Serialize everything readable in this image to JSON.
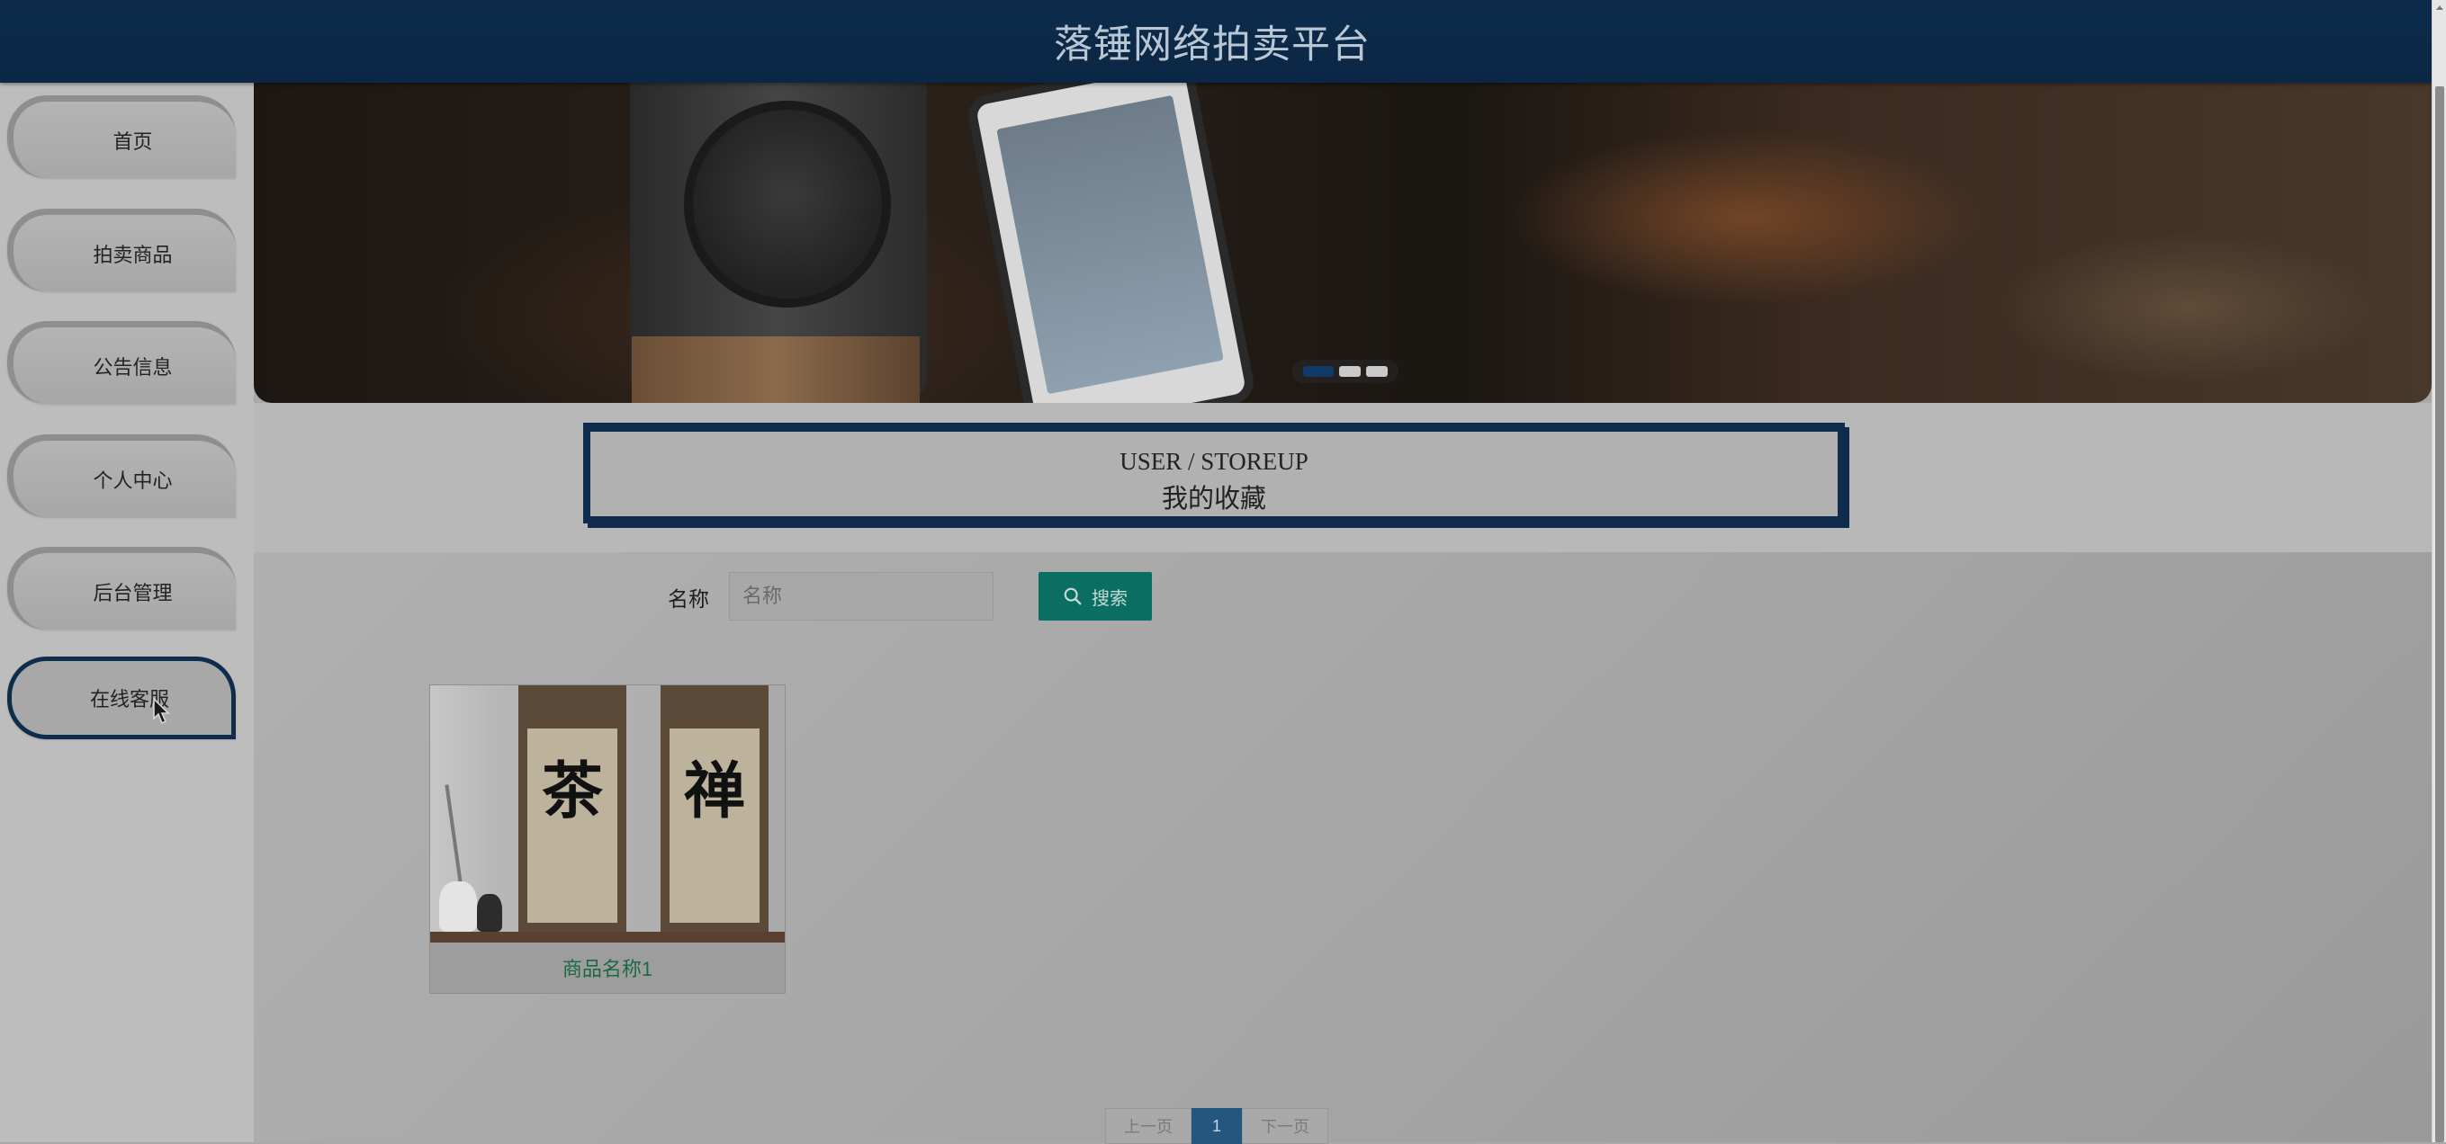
{
  "header": {
    "title": "落锤网络拍卖平台"
  },
  "sidebar": {
    "items": [
      {
        "label": "首页"
      },
      {
        "label": "拍卖商品"
      },
      {
        "label": "公告信息"
      },
      {
        "label": "个人中心"
      },
      {
        "label": "后台管理"
      },
      {
        "label": "在线客服",
        "active": true
      }
    ]
  },
  "banner": {
    "slide_count": 3,
    "active_slide": 1
  },
  "page_heading": {
    "en": "USER / STOREUP",
    "cn": "我的收藏"
  },
  "search": {
    "label": "名称",
    "placeholder": "名称",
    "value": "",
    "button_label": "搜索"
  },
  "products": [
    {
      "name": "商品名称1",
      "scroll_left_char": "茶",
      "scroll_right_char": "禅"
    }
  ],
  "pagination": {
    "prev_label": "上一页",
    "current_page": "1",
    "next_label": "下一页"
  },
  "colors": {
    "header_bg": "#0d2b4b",
    "accent_navy": "#0f2c4c",
    "search_button": "#0b6e62",
    "product_name": "#1c6a45",
    "page_current": "#23577f"
  }
}
